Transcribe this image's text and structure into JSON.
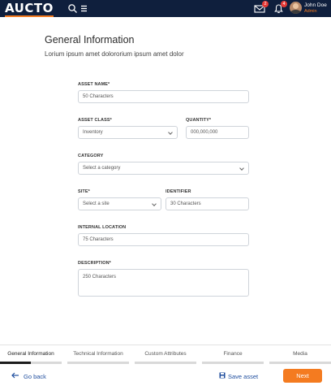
{
  "header": {
    "logo": "AUCTO",
    "logo_accent": "#f47b20",
    "bg_color": "#0f1f3d",
    "icons": [
      "search-icon",
      "menu-icon",
      "mail-icon",
      "bell-icon"
    ],
    "mail_badge": "2",
    "bell_badge": "4",
    "user_name": "John Doe",
    "user_role": "Admin"
  },
  "form": {
    "title": "General Information",
    "subtitle": "Lorium ipsum amet dolororium ipsum amet dolor",
    "asset_name": {
      "label": "ASSET NAME*",
      "placeholder": "50 Characters"
    },
    "asset_class": {
      "label": "ASSET CLASS*",
      "value": "Inventory"
    },
    "quantity": {
      "label": "QUANTITY*",
      "placeholder": "000,000,000"
    },
    "category": {
      "label": "CATEGORY",
      "value": "Select a category"
    },
    "site": {
      "label": "SITE*",
      "value": "Select a site"
    },
    "identifier": {
      "label": "IDENTIFIER",
      "placeholder": "30 Characters"
    },
    "internal_location": {
      "label": "INTERNAL LOCATION",
      "placeholder": "75 Characters"
    },
    "description": {
      "label": "DESCRIPTION*",
      "placeholder": "250 Characters"
    }
  },
  "tabs": [
    {
      "label": "General Information",
      "active": true
    },
    {
      "label": "Technical Information",
      "active": false
    },
    {
      "label": "Custom Attributes",
      "active": false
    },
    {
      "label": "Finance",
      "active": false
    },
    {
      "label": "Media",
      "active": false
    }
  ],
  "footer": {
    "go_back": "Go back",
    "save_asset": "Save asset",
    "next": "Next",
    "next_color": "#f47b20",
    "link_color": "#1f4e9e"
  }
}
